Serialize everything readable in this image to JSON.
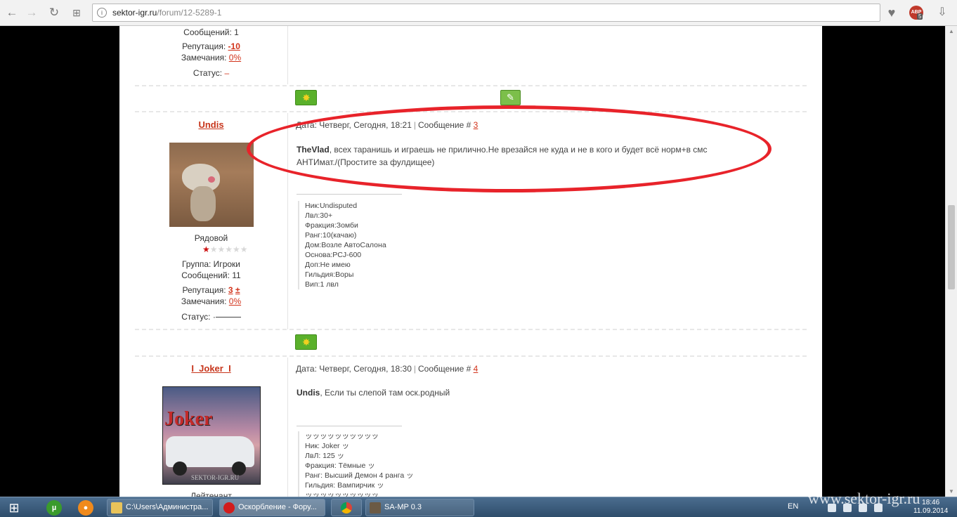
{
  "browser": {
    "url_domain": "sektor-igr.ru",
    "url_path": "/forum/12-5289-1",
    "abp_label": "ABP",
    "abp_badge": "5"
  },
  "post_prev": {
    "messages": "Сообщений: 1",
    "rep_label": "Репутация:",
    "rep_value": "-10",
    "warn_label": "Замечания:",
    "warn_value": "0%",
    "status_label": "Статус:",
    "status_value": "–"
  },
  "post3": {
    "username": "Undis",
    "date_label": "Дата:",
    "date_value": "Четверг, Сегодня, 18:21",
    "msg_label": "Сообщение #",
    "msg_num": "3",
    "rank": "Рядовой",
    "group": "Группа: Игроки",
    "messages": "Сообщений: 11",
    "rep_label": "Репутация:",
    "rep_value": "3",
    "rep_plusminus": "±",
    "warn_label": "Замечания:",
    "warn_value": "0%",
    "status_label": "Статус:",
    "status_value": "·",
    "quote_author": "TheVlad",
    "body_line1": ", всех таранишь и играешь не прилично.Не врезайся не куда и не в кого и будет всё норм+в смс",
    "body_line2": "АНТИмат./(Простите за фулдищее)",
    "signature": [
      "Ник:Undisputed",
      "Лвл:30+",
      "Фракция:Зомби",
      "Ранг:10(качаю)",
      "Дом:Возле АвтоСалона",
      "Основа:PCJ-600",
      "Доп:Не имею",
      "Гильдия:Воры",
      "Вип:1 лвл"
    ]
  },
  "post4": {
    "username": "I_Joker_I",
    "date_label": "Дата:",
    "date_value": "Четверг, Сегодня, 18:30",
    "msg_label": "Сообщение #",
    "msg_num": "4",
    "rank": "Лейтенант",
    "avatar_text": "Joker",
    "avatar_watermark": "SEKTOR-IGR.RU",
    "quote_author": "Undis",
    "body": ", Если ты слепой там оск.родный",
    "signature": [
      "ッッッッッッッッッッ",
      "Ник: Joker ッ",
      "ЛвЛ: 125 ッ",
      "Фракция: Тёмные ッ",
      "Ранг: Высший Демон 4 ранга ッ",
      "Гильдия: Вампирчик ッ",
      "ッッッッッッッッッッ"
    ]
  },
  "taskbar": {
    "explorer_label": "C:\\Users\\Администра...",
    "opera_label": "Оскорбление - Фору...",
    "samp_label": "SA-MP 0.3",
    "lang": "EN",
    "time": "18:46",
    "date": "11.09.2014",
    "watermark": "www.sektor-igr.ru"
  },
  "colors": {
    "link": "#d2331b",
    "highlight_ellipse": "#e8232a",
    "green_button": "#5ab02b"
  }
}
